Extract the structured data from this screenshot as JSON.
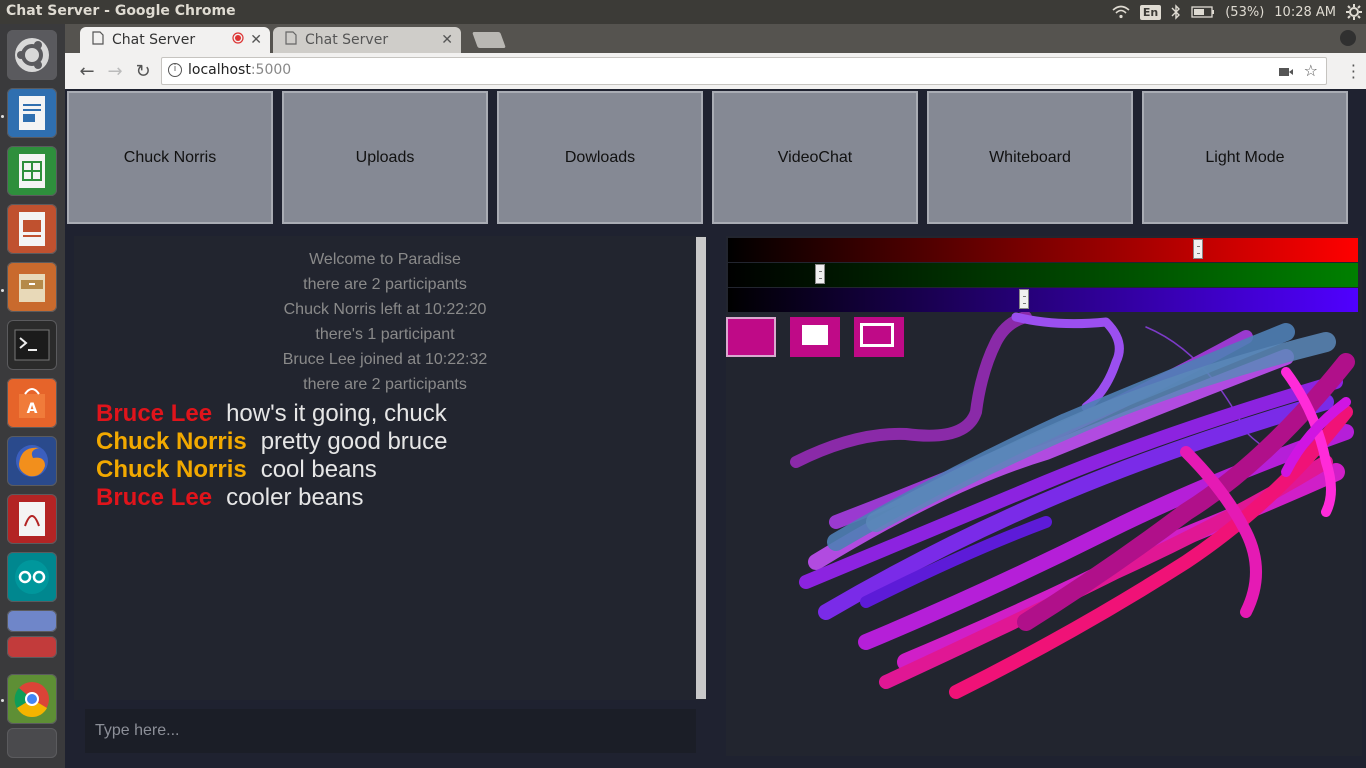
{
  "window": {
    "title": "Chat Server - Google Chrome"
  },
  "tray": {
    "language": "En",
    "battery": "(53%)",
    "clock": "10:28 AM"
  },
  "browser": {
    "tabs": [
      {
        "label": "Chat Server",
        "active": true,
        "recording": true
      },
      {
        "label": "Chat Server",
        "active": false
      }
    ],
    "url_host": "localhost",
    "url_port": ":5000"
  },
  "nav": {
    "buttons": [
      "Chuck Norris",
      "Uploads",
      "Dowloads",
      "VideoChat",
      "Whiteboard",
      "Light Mode"
    ]
  },
  "chat": {
    "system_messages": [
      "Welcome to Paradise",
      "there are 2 participants",
      "Chuck Norris left at 10:22:20",
      "there's 1 participant",
      "Bruce Lee joined at 10:22:32",
      "there are 2 participants"
    ],
    "messages": [
      {
        "user": "Bruce Lee",
        "text": "how's it going, chuck",
        "color": "#e0141b"
      },
      {
        "user": "Chuck Norris",
        "text": "pretty good bruce",
        "color": "#f2a900"
      },
      {
        "user": "Chuck Norris",
        "text": "cool beans",
        "color": "#f2a900"
      },
      {
        "user": "Bruce Lee",
        "text": "cooler beans",
        "color": "#e0141b"
      }
    ],
    "input_placeholder": "Type here..."
  },
  "whiteboard": {
    "red": 0.75,
    "green": 0.14,
    "blue": 0.47,
    "current_color": "#bf0a87",
    "tools": [
      "fill-swatch",
      "small-brush",
      "large-brush"
    ]
  }
}
